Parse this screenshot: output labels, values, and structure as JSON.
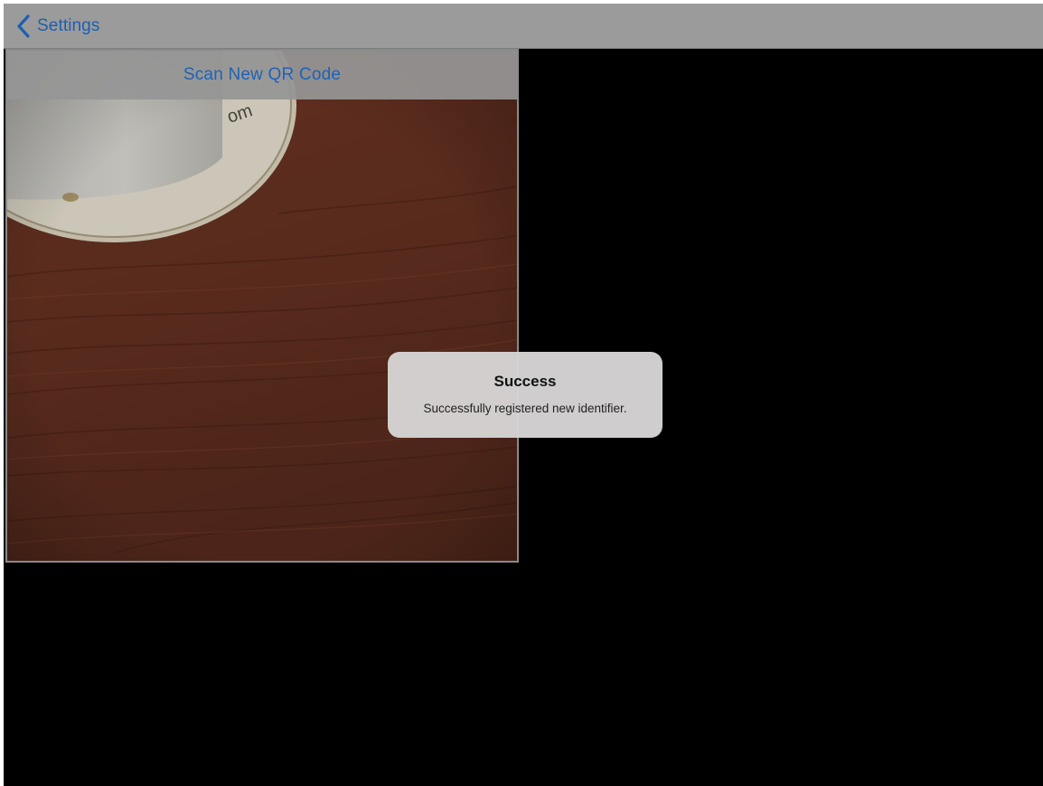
{
  "navigation": {
    "back_label": "Settings",
    "back_icon": "chevron-left-icon",
    "tint_color": "#1d5fb0",
    "bar_color": "#9b9b9b"
  },
  "scanner": {
    "scan_button_label": "Scan New QR Code",
    "camera_subject": "coffee cup on coaster over wooden desk"
  },
  "alert": {
    "title": "Success",
    "message": "Successfully registered new identifier."
  },
  "colors": {
    "background": "#000000",
    "alert_background": "#d6d4d4",
    "desk_wood": "#6b3424"
  }
}
